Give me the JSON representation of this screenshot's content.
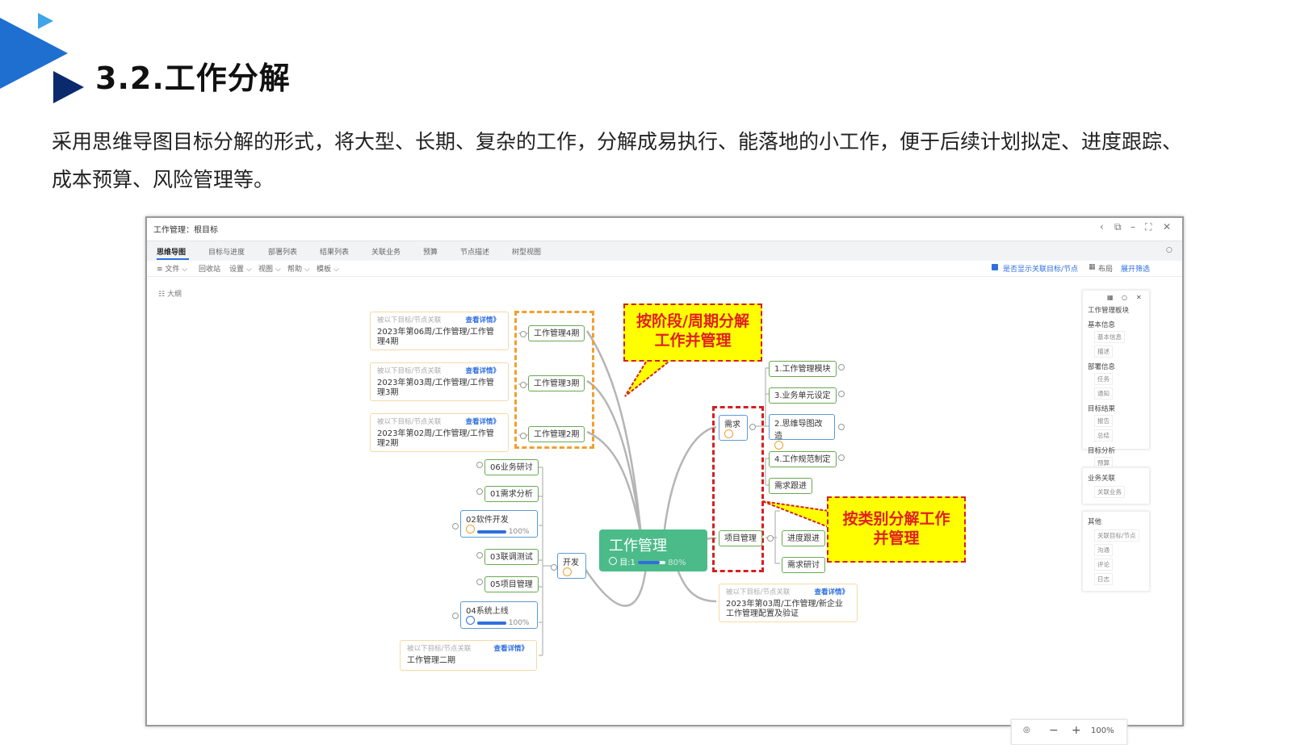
{
  "slide": {
    "title": "3.2.工作分解",
    "intro_line1": "采用思维导图目标分解的形式，将大型、长期、复杂的工作，分解成易执行、能落地的小工作，便于后续计划拟定、进度跟踪、",
    "intro_line2": "成本预算、风险管理等。"
  },
  "window": {
    "title": "工作管理：根目标",
    "tabs": [
      "思维导图",
      "目标与进度",
      "部署列表",
      "结果列表",
      "关联业务",
      "预算",
      "节点描述",
      "树型视图"
    ],
    "toolbar": [
      "≡ 文件 ⌵",
      "回收站",
      "设置 ⌵",
      "视图 ⌵",
      "帮助 ⌵",
      "模板 ⌵"
    ],
    "show_related_label": "是否显示关联目标/节点",
    "layout_label": "布局",
    "expand_filter_label": "展开筛选",
    "outline_label": "大纲"
  },
  "mindmap": {
    "center": {
      "label": "工作管理",
      "meta": "目:1",
      "progress": "80%"
    },
    "card_sub": "被以下目标/节点关联",
    "card_link": "查看详情》",
    "left_cards": [
      {
        "text": "2023年第06周/工作管理/工作管理4期",
        "node": "工作管理4期"
      },
      {
        "text": "2023年第03周/工作管理/工作管理3期",
        "node": "工作管理3期"
      },
      {
        "text": "2023年第02周/工作管理/工作管理2期",
        "node": "工作管理2期"
      }
    ],
    "dev": {
      "label": "开发",
      "children": [
        "06业务研讨",
        "01需求分析",
        "02软件开发",
        "03联调测试",
        "05项目管理",
        "04系统上线"
      ],
      "progress_software": "100%",
      "progress_launch": "100%",
      "bottom_card_text": "工作管理二期"
    },
    "requirements": {
      "label": "需求",
      "children": [
        "1.工作管理模块",
        "3.业务单元设定",
        "2.思维导图改造",
        "4.工作规范制定",
        "需求跟进"
      ]
    },
    "project": {
      "label": "项目管理",
      "children": [
        "进度跟进",
        "需求研讨"
      ],
      "card_text": "2023年第03周/工作管理/新企业工作管理配置及验证"
    },
    "callout_top": {
      "line1": "按阶段/周期分解",
      "line2": "工作并管理"
    },
    "callout_right": {
      "line1": "按类别分解工作",
      "line2": "并管理"
    }
  },
  "side_panel": {
    "title": "工作管理板块",
    "sections": [
      {
        "name": "基本信息",
        "items": [
          "基本信息",
          "描述"
        ]
      },
      {
        "name": "部署信息",
        "items": [
          "任务",
          "通知"
        ]
      },
      {
        "name": "目标结果",
        "items": [
          "报告",
          "总结"
        ]
      },
      {
        "name": "目标分析",
        "items": [
          "预算"
        ]
      }
    ],
    "section2": {
      "name": "业务关联",
      "items": [
        "关联业务"
      ]
    },
    "section3": {
      "name": "其他",
      "items": [
        "关联目标/节点",
        "沟通",
        "评论",
        "日志"
      ]
    }
  },
  "zoom": {
    "level": "100%"
  },
  "colors": {
    "accent_blue": "#1f6fd1",
    "dark_blue": "#0b2a6e",
    "center_green": "#4cbb8a",
    "callout_yellow": "#ffff00",
    "callout_red": "#e02020",
    "dash_orange": "#f0a030"
  }
}
